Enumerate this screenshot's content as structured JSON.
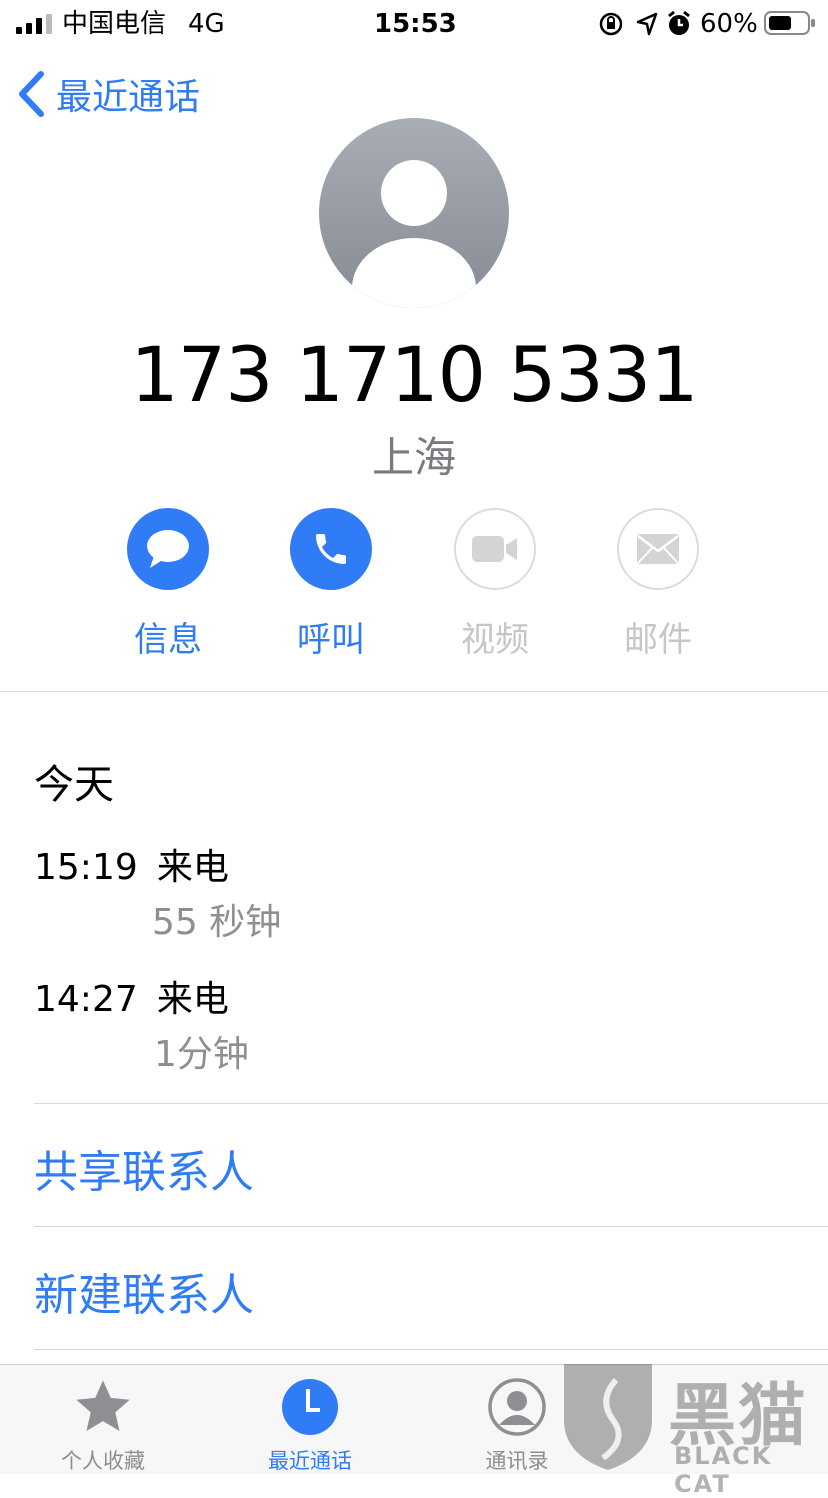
{
  "status_bar": {
    "carrier": "中国电信",
    "network": "4G",
    "time": "15:53",
    "battery": "60%"
  },
  "nav": {
    "back_label": "最近通话"
  },
  "contact": {
    "phone": "173 1710 5331",
    "location": "上海"
  },
  "actions": [
    {
      "label": "信息",
      "icon": "message-bubble-icon",
      "enabled": true
    },
    {
      "label": "呼叫",
      "icon": "phone-icon",
      "enabled": true
    },
    {
      "label": "视频",
      "icon": "video-camera-icon",
      "enabled": false
    },
    {
      "label": "邮件",
      "icon": "envelope-icon",
      "enabled": false
    }
  ],
  "history": {
    "section_title": "今天",
    "calls": [
      {
        "time": "15:19",
        "type": "来电",
        "duration": "55 秒钟"
      },
      {
        "time": "14:27",
        "type": "来电",
        "duration": "1分钟"
      }
    ]
  },
  "links": {
    "share_contact": "共享联系人",
    "new_contact": "新建联系人"
  },
  "tabbar": {
    "tabs": [
      {
        "label": "个人收藏",
        "icon": "star-icon",
        "active": false
      },
      {
        "label": "最近通话",
        "icon": "clock-icon",
        "active": true
      },
      {
        "label": "通讯录",
        "icon": "contacts-icon",
        "active": false
      }
    ]
  },
  "watermark": {
    "text": "黑猫",
    "sub": "BLACK CAT"
  },
  "colors": {
    "accent": "#2f7cf6",
    "secondary_text": "#8e8e93",
    "disabled": "#c6c6c9"
  }
}
